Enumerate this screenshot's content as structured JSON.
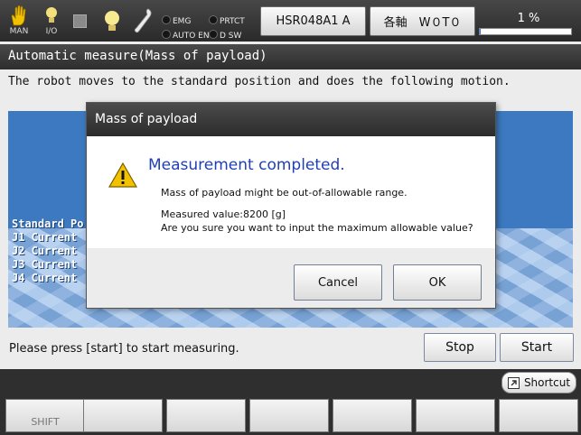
{
  "toolbar": {
    "mode_label": "MAN",
    "io_label": "I/O",
    "lamps": {
      "emg": "EMG",
      "prtct": "PRTCT",
      "auto_en": "AUTO EN",
      "d_sw": "D SW"
    },
    "robot_button": "HSR048A1 A",
    "axis_button": "各軸　W０T０",
    "progress_text": "1 %",
    "progress_percent": 1
  },
  "screen": {
    "title": "Automatic measure(Mass of payload)",
    "subtitle": "The robot moves to the standard position and does the following motion.",
    "overlay_lines": [
      "Standard Po",
      "J1 Current",
      "J2 Current",
      "J3 Current",
      "J4 Current"
    ],
    "instruction": "Please press [start] to start measuring.",
    "stop_label": "Stop",
    "start_label": "Start"
  },
  "dialog": {
    "title": "Mass of payload",
    "heading": "Measurement completed.",
    "line1": "Mass of payload might be out-of-allowable range.",
    "line2": "Measured value:8200 [g]",
    "line3": "Are you sure you want to input the maximum allowable value?",
    "cancel_label": "Cancel",
    "ok_label": "OK",
    "icon": "warning-icon"
  },
  "footer": {
    "shortcut_label": "Shortcut",
    "fkeys": [
      "SHIFT",
      "",
      "",
      "",
      "",
      "",
      ""
    ]
  },
  "colors": {
    "dialog_heading": "#1f3fb5",
    "view_background": "#3c79c0",
    "progress_fill": "#2a7ad8",
    "warning": "#f2c200"
  }
}
